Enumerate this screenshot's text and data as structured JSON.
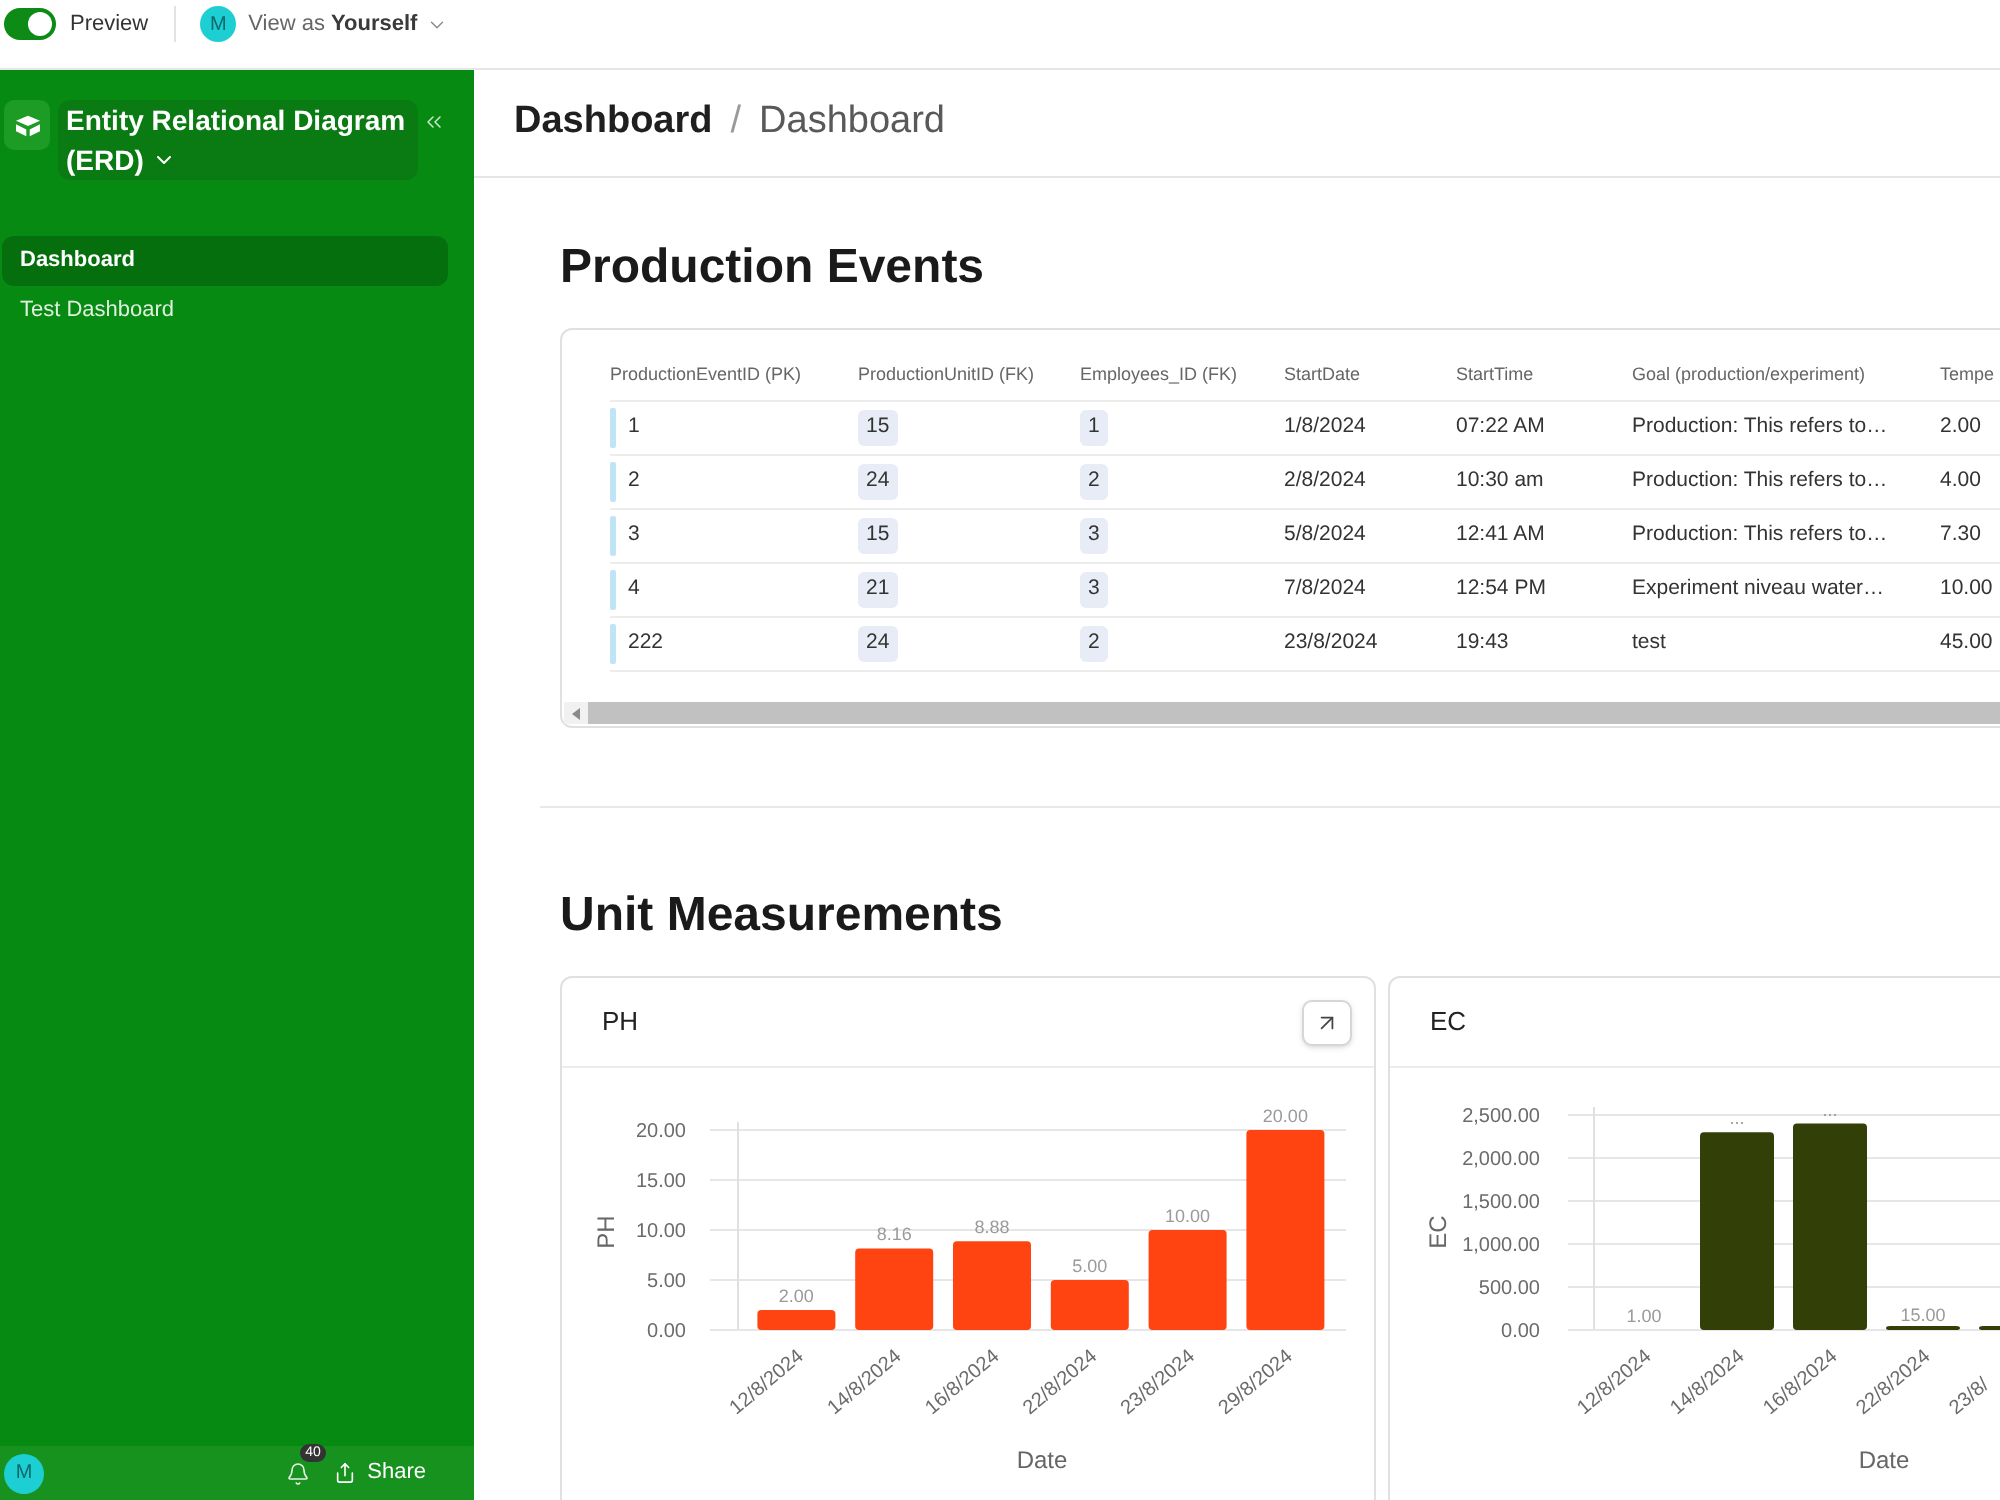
{
  "top_bar": {
    "preview_toggle": {
      "label": "Preview",
      "on": true
    },
    "view_as": {
      "avatar_initial": "M",
      "label": "View as **Yourself**"
    }
  },
  "sidebar": {
    "title": "Entity Relational Diagram (ERD)",
    "items": [
      {
        "label": "Dashboard",
        "selected": true
      },
      {
        "label": "Test Dashboard",
        "selected": false
      }
    ],
    "footer": {
      "avatar_initial": "M",
      "notification_count": "40",
      "share_label": "Share"
    }
  },
  "breadcrumb": {
    "parent": "Dashboard",
    "separator": "/",
    "current": "Dashboard"
  },
  "sections": [
    {
      "kind": "table",
      "title": "Production Events",
      "table": {
        "columns": [
          {
            "label": "ProductionEventID (PK)",
            "kind": "text"
          },
          {
            "label": "ProductionUnitID (FK)",
            "kind": "link"
          },
          {
            "label": "Employees_ID (FK)",
            "kind": "link"
          },
          {
            "label": "StartDate",
            "kind": "text"
          },
          {
            "label": "StartTime",
            "kind": "text"
          },
          {
            "label": "Goal (production/experiment)",
            "kind": "text"
          },
          {
            "label": "Tempe",
            "kind": "text"
          }
        ],
        "rows": [
          [
            "1",
            "15",
            "1",
            "1/8/2024",
            "07:22 AM",
            "Production: This refers to…",
            "2.00"
          ],
          [
            "2",
            "24",
            "2",
            "2/8/2024",
            "10:30 am",
            "Production: This refers to…",
            "4.00"
          ],
          [
            "3",
            "15",
            "3",
            "5/8/2024",
            "12:41 AM",
            "Production: This refers to…",
            "7.30"
          ],
          [
            "4",
            "21",
            "3",
            "7/8/2024",
            "12:54 PM",
            "Experiment niveau water…",
            "10.00"
          ],
          [
            "222",
            "24",
            "2",
            "23/8/2024",
            "19:43",
            "test",
            "45.00"
          ]
        ]
      }
    },
    {
      "kind": "charts",
      "title": "Unit Measurements",
      "cards": [
        {
          "title": "PH",
          "expand_button": true,
          "chart_data": {
            "type": "bar",
            "xlabel": "Date",
            "ylabel": "PH",
            "grid": true,
            "categories": [
              "12/8/2024",
              "14/8/2024",
              "16/8/2024",
              "22/8/2024",
              "23/8/2024",
              "29/8/2024"
            ],
            "series": [
              {
                "color": "#ff4411",
                "values": [
                  2,
                  8.16,
                  8.88,
                  5,
                  10,
                  20
                ]
              }
            ],
            "ylim": [
              0,
              20
            ],
            "yticks": [
              {
                "value": 0,
                "label": "0.00"
              },
              {
                "value": 5,
                "label": "5.00"
              },
              {
                "value": 10,
                "label": "10.00"
              },
              {
                "value": 15,
                "label": "15.00"
              },
              {
                "value": 20,
                "label": "20.00"
              }
            ],
            "value_labels": [
              "2.00",
              "8.16",
              "8.88",
              "5.00",
              "10.00",
              "20.00"
            ]
          }
        },
        {
          "title": "EC",
          "chart_data": {
            "type": "bar",
            "xlabel": "Date",
            "ylabel": "EC",
            "grid": true,
            "categories": [
              "12/8/2024",
              "14/8/2024",
              "16/8/2024",
              "22/8/2024",
              "23/8/"
            ],
            "series": [
              {
                "color": "#323f06",
                "values": [
                  1,
                  2300,
                  2400,
                  15,
                  20
                ]
              }
            ],
            "ylim": [
              0,
              2500
            ],
            "yticks": [
              {
                "value": 0,
                "label": "0.00"
              },
              {
                "value": 500,
                "label": "500.00"
              },
              {
                "value": 1000,
                "label": "1,000.00"
              },
              {
                "value": 1500,
                "label": "1,500.00"
              },
              {
                "value": 2000,
                "label": "2,000.00"
              },
              {
                "value": 2500,
                "label": "2,500.00"
              }
            ],
            "value_labels": [
              "1.00",
              "...",
              "...",
              "15.00",
              null
            ]
          }
        }
      ]
    }
  ]
}
